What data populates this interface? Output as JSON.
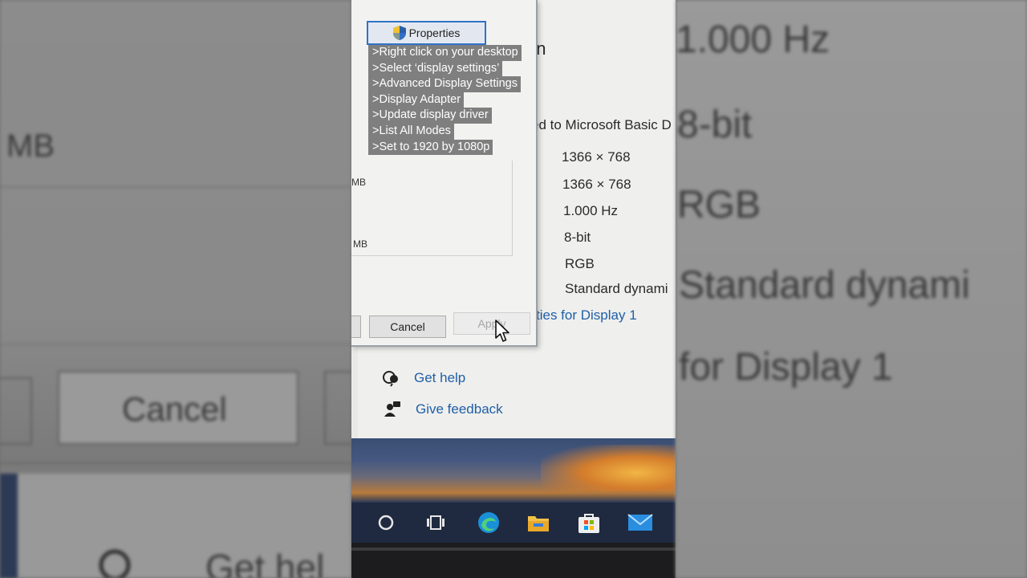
{
  "dialog": {
    "properties_label": "Properties",
    "mb_1": "MB",
    "mb_2": "MB",
    "cancel_label": "Cancel",
    "apply_label": "Apply"
  },
  "settings": {
    "title_fragment": "on",
    "connected_fragment": "ed to Microsoft Basic D",
    "resolution_1": "1366 × 768",
    "resolution_2": "1366 × 768",
    "refresh_rate": "1.000 Hz",
    "bit_depth": "8-bit",
    "color_format": "RGB",
    "color_space": "Standard dynami",
    "adapter_link": "ties for Display 1",
    "get_help": "Get help",
    "give_feedback": "Give feedback"
  },
  "steps": [
    ">Right click on your desktop",
    ">Select ‘display settings’",
    ">Advanced Display Settings",
    ">Display Adapter",
    ">Update display driver",
    ">List All Modes",
    ">Set to 1920 by 1080p"
  ],
  "left_blur": {
    "mb": "MB",
    "cancel": "Cancel",
    "get_help": "Get hel"
  },
  "right_blur": {
    "refresh": "1.000 Hz",
    "bit": "8-bit",
    "rgb": "RGB",
    "dynamic": "Standard dynami",
    "display": "for Display 1"
  },
  "taskbar": {
    "icons": [
      "cortana-icon",
      "task-view-icon",
      "edge-icon",
      "file-explorer-icon",
      "store-icon",
      "mail-icon"
    ]
  },
  "colors": {
    "link": "#1f5fa8",
    "focus_border": "#2f73c9",
    "taskbar": "#1f2a40"
  }
}
